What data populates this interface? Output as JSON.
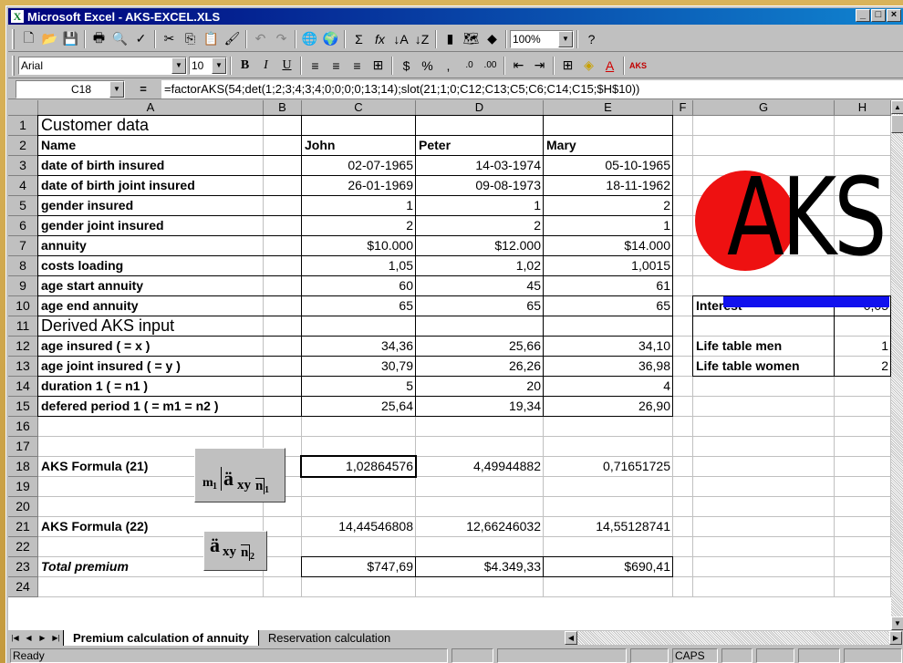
{
  "window": {
    "title": "Microsoft Excel - AKS-EXCEL.XLS",
    "app_icon": "X"
  },
  "toolbar": {
    "font_name": "Arial",
    "font_size": "10",
    "zoom": "100%"
  },
  "formula_bar": {
    "cell_ref": "C18",
    "equals": "=",
    "formula": "=factorAKS(54;det(1;2;3;4;3;4;0;0;0;0;13;14);slot(21;1;0;C12;C13;C5;C6;C14;C15;$H$10))"
  },
  "columns": [
    "A",
    "B",
    "C",
    "D",
    "E",
    "F",
    "G",
    "H"
  ],
  "rows": [
    "1",
    "2",
    "3",
    "4",
    "5",
    "6",
    "7",
    "8",
    "9",
    "10",
    "11",
    "12",
    "13",
    "14",
    "15",
    "16",
    "17",
    "18",
    "19",
    "20",
    "21",
    "22",
    "23",
    "24"
  ],
  "cells": {
    "a1": "Customer data",
    "a2": "Name",
    "c2": "John",
    "d2": "Peter",
    "e2": "Mary",
    "a3": "date of birth insured",
    "c3": "02-07-1965",
    "d3": "14-03-1974",
    "e3": "05-10-1965",
    "a4": "date of birth joint insured",
    "c4": "26-01-1969",
    "d4": "09-08-1973",
    "e4": "18-11-1962",
    "a5": "gender insured",
    "c5": "1",
    "d5": "1",
    "e5": "2",
    "a6": "gender joint insured",
    "c6": "2",
    "d6": "2",
    "e6": "1",
    "a7": "annuity",
    "c7": "$10.000",
    "d7": "$12.000",
    "e7": "$14.000",
    "a8": "costs loading",
    "c8": "1,05",
    "d8": "1,02",
    "e8": "1,0015",
    "a9": "age start annuity",
    "c9": "60",
    "d9": "45",
    "e9": "61",
    "a10": "age end annuity",
    "c10": "65",
    "d10": "65",
    "e10": "65",
    "a11": "Derived AKS input",
    "a12": "age insured ( = x )",
    "c12": "34,36",
    "d12": "25,66",
    "e12": "34,10",
    "a13": "age joint insured ( = y )",
    "c13": "30,79",
    "d13": "26,26",
    "e13": "36,98",
    "a14": "duration 1 ( = n1 )",
    "c14": "5",
    "d14": "20",
    "e14": "4",
    "a15": "defered period 1 ( = m1 = n2 )",
    "c15": "25,64",
    "d15": "19,34",
    "e15": "26,90",
    "a18": "AKS Formula (21)",
    "c18": "1,02864576",
    "d18": "4,49944882",
    "e18": "0,71651725",
    "a21": "AKS Formula (22)",
    "c21": "14,44546808",
    "d21": "12,66246032",
    "e21": "14,55128741",
    "a23": "Total premium",
    "c23": "$747,69",
    "d23": "$4.349,33",
    "e23": "$690,41",
    "g10": "Interest",
    "h10": "0,05",
    "g12": "Life table men",
    "h12": "1",
    "g13": "Life table women",
    "h13": "2"
  },
  "logo": {
    "text": "AKS",
    "circle_color": "#ee1111",
    "bar_color": "#1111ee"
  },
  "formula_images": {
    "f21": {
      "sub_m": "m",
      "sub_1": "1",
      "a": "ä",
      "xy": "xy",
      "n": "n",
      "n_sub": "1"
    },
    "f22": {
      "a": "ä",
      "xy": "xy",
      "n": "n",
      "n_sub": "2"
    }
  },
  "tabs": {
    "active": "Premium calculation of annuity",
    "other": "Reservation calculation"
  },
  "status": {
    "ready": "Ready",
    "caps": "CAPS"
  }
}
